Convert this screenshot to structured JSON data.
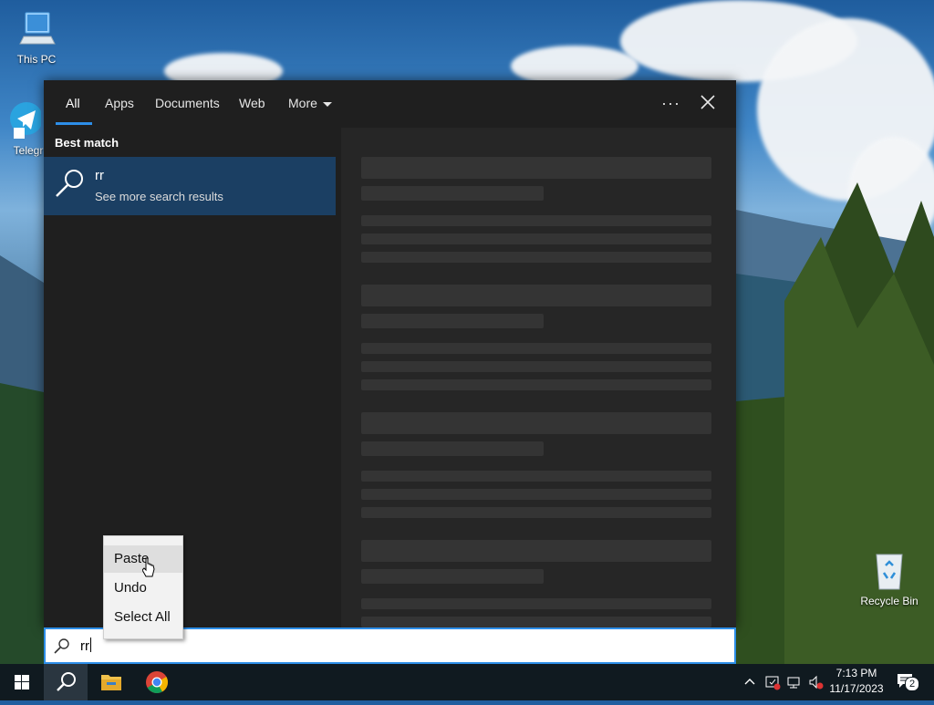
{
  "desktop": {
    "icons": [
      {
        "name": "this-pc",
        "label": "This PC"
      },
      {
        "name": "telegram",
        "label": "Telegr"
      },
      {
        "name": "recycle-bin",
        "label": "Recycle Bin"
      }
    ]
  },
  "search_panel": {
    "tabs": [
      "All",
      "Apps",
      "Documents",
      "Web",
      "More"
    ],
    "active_tab": "All",
    "options_label": "···",
    "best_match_heading": "Best match",
    "result": {
      "title": "rr",
      "subtitle": "See more search results"
    }
  },
  "context_menu": {
    "items": [
      "Paste",
      "Undo",
      "Select All"
    ],
    "hovered": "Paste"
  },
  "search_box": {
    "value": "rr"
  },
  "taskbar": {
    "apps": [
      "start-button",
      "search",
      "file-explorer",
      "chrome"
    ],
    "clock": {
      "time": "7:13 PM",
      "date": "11/17/2023"
    },
    "notification_count": "2"
  },
  "colors": {
    "accent": "#2d8ee8",
    "selected_result": "#1b3f63",
    "panel_bg": "#1f1f1f"
  }
}
